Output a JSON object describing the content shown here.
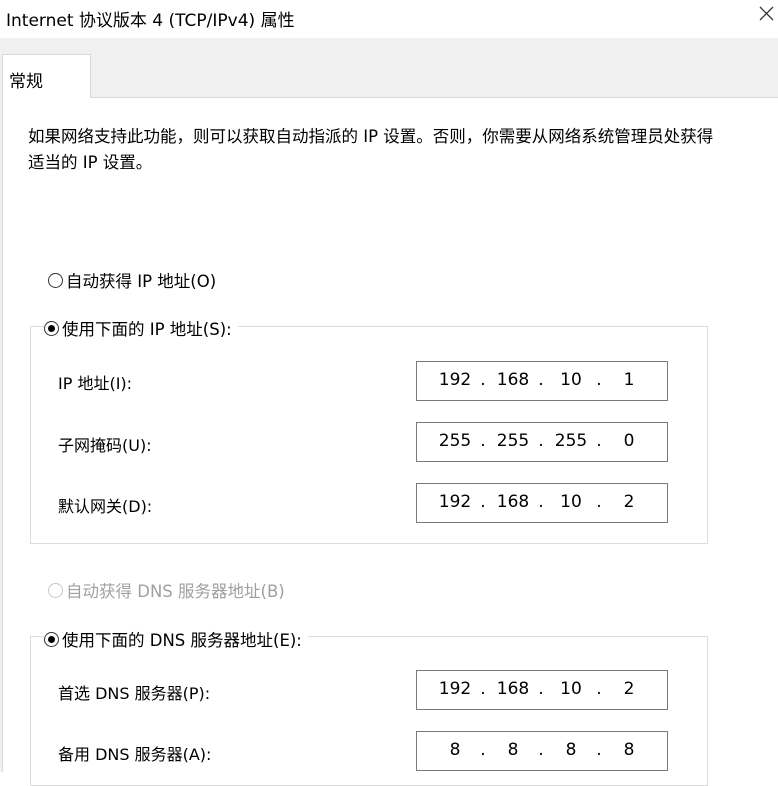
{
  "window": {
    "title": "Internet 协议版本 4 (TCP/IPv4) 属性",
    "close_glyph": "✕"
  },
  "tabs": [
    {
      "label": "常规",
      "active": true
    }
  ],
  "description": "如果网络支持此功能，则可以获取自动指派的 IP 设置。否则，你需要从网络系统管理员处获得适当的 IP 设置。",
  "ip_section": {
    "auto_option": {
      "label": "自动获得 IP 地址(O)",
      "checked": false,
      "enabled": true
    },
    "manual_option": {
      "label": "使用下面的 IP 地址(S):",
      "checked": true,
      "enabled": true
    },
    "fields": [
      {
        "label": "IP 地址(I):",
        "octets": [
          "192",
          "168",
          "10",
          "1"
        ]
      },
      {
        "label": "子网掩码(U):",
        "octets": [
          "255",
          "255",
          "255",
          "0"
        ]
      },
      {
        "label": "默认网关(D):",
        "octets": [
          "192",
          "168",
          "10",
          "2"
        ]
      }
    ]
  },
  "dns_section": {
    "auto_option": {
      "label": "自动获得 DNS 服务器地址(B)",
      "checked": false,
      "enabled": false
    },
    "manual_option": {
      "label": "使用下面的 DNS 服务器地址(E):",
      "checked": true,
      "enabled": true
    },
    "fields": [
      {
        "label": "首选 DNS 服务器(P):",
        "octets": [
          "192",
          "168",
          "10",
          "2"
        ]
      },
      {
        "label": "备用 DNS 服务器(A):",
        "octets": [
          "8",
          "8",
          "8",
          "8"
        ]
      }
    ]
  },
  "octet_separator": "."
}
